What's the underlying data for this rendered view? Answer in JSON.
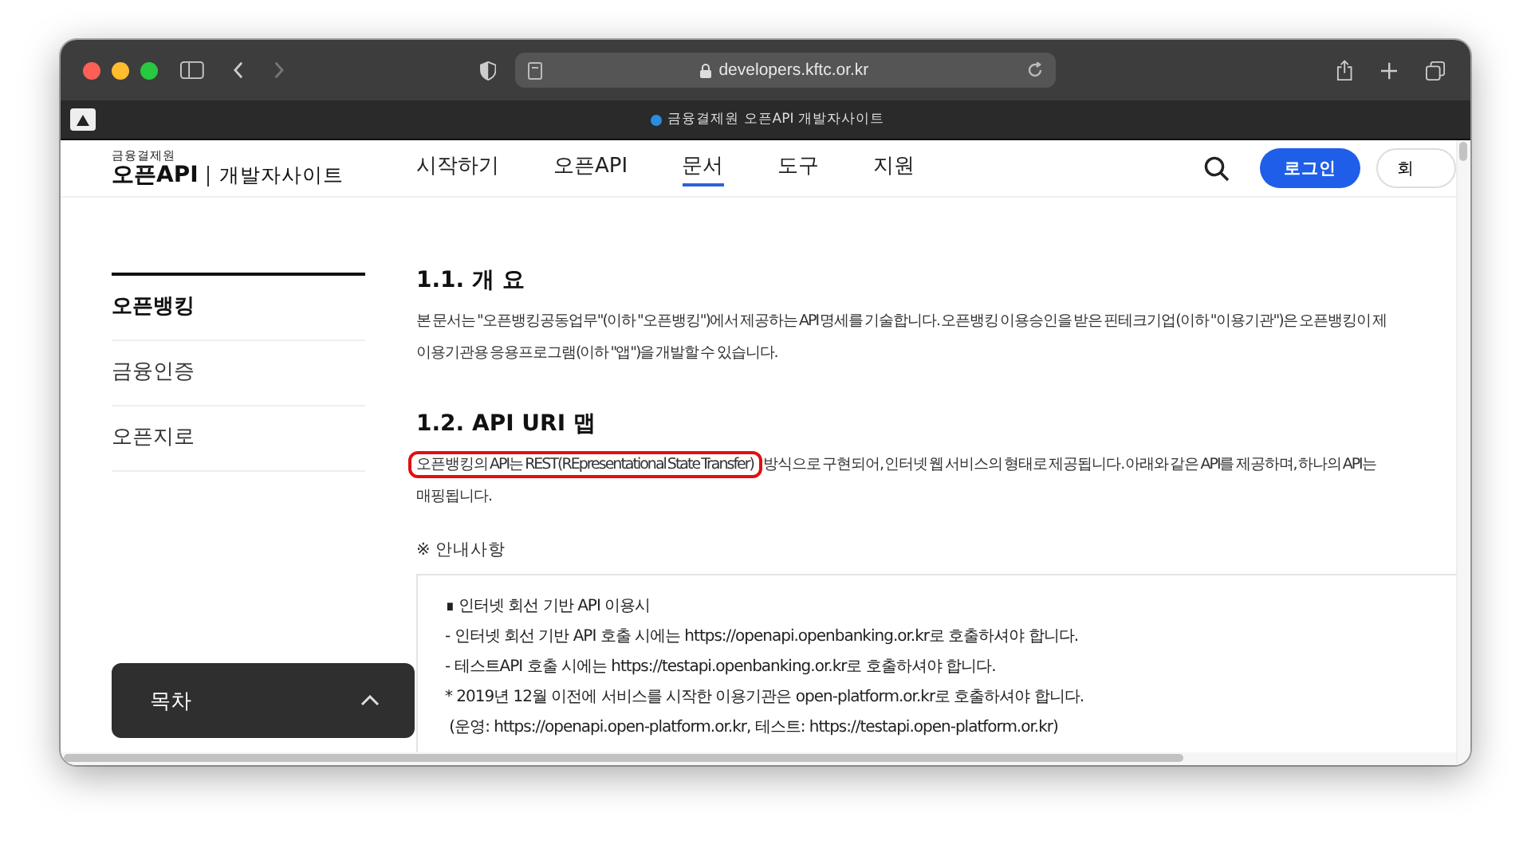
{
  "browser": {
    "url": "developers.kftc.or.kr",
    "tab_title": "금융결제원 오픈API 개발자사이트"
  },
  "header": {
    "brand_small": "금융결제원",
    "brand": "오픈API",
    "brand_sub": "개발자사이트",
    "nav": [
      {
        "label": "시작하기",
        "selected": false
      },
      {
        "label": "오픈API",
        "selected": false
      },
      {
        "label": "문서",
        "selected": true
      },
      {
        "label": "도구",
        "selected": false
      },
      {
        "label": "지원",
        "selected": false
      }
    ],
    "login": "로그인",
    "signup": "회"
  },
  "sidebar": {
    "items": [
      {
        "label": "오픈뱅킹",
        "selected": true
      },
      {
        "label": "금융인증",
        "selected": false
      },
      {
        "label": "오픈지로",
        "selected": false
      }
    ],
    "toc_button": "목차"
  },
  "sections": [
    {
      "title": "1.1. 개 요",
      "lines": [
        {
          "text": "본 문서는 \"오픈뱅킹공동업무\"(이하 \"오픈뱅킹\")에서 제공하는 API 명세를 기술합니다. 오픈뱅킹 이용승인을 받은 핀테크기업(이하 \"이용기관\")은 오픈뱅킹이 제"
        },
        {
          "text": "이용기관용 응용프로그램(이하 \"앱\")을 개발할 수 있습니다."
        }
      ]
    },
    {
      "title": "1.2. API URI 맵",
      "lines": [
        {
          "highlight": "오픈뱅킹의 API는 REST(REpresentational State Transfer)",
          "text": "방식으로 구현되어, 인터넷 웹 서비스의 형태로 제공됩니다. 아래와 같은 API를 제공하며, 하나의 API는"
        },
        {
          "text": "매핑됩니다."
        }
      ]
    }
  ],
  "notice": {
    "heading": "※ 안내사항",
    "lines": [
      "∎ 인터넷 회선 기반 API 이용시",
      "- 인터넷 회선 기반 API 호출 시에는 https://openapi.openbanking.or.kr로 호출하셔야 합니다.",
      "- 테스트API 호출 시에는 https://testapi.openbanking.or.kr로 호출하셔야 합니다.",
      "* 2019년 12월 이전에 서비스를 시작한 이용기관은 open-platform.or.kr로 호출하셔야 합니다.",
      " (운영: https://openapi.open-platform.or.kr, 테스트: https://testapi.open-platform.or.kr)"
    ]
  }
}
